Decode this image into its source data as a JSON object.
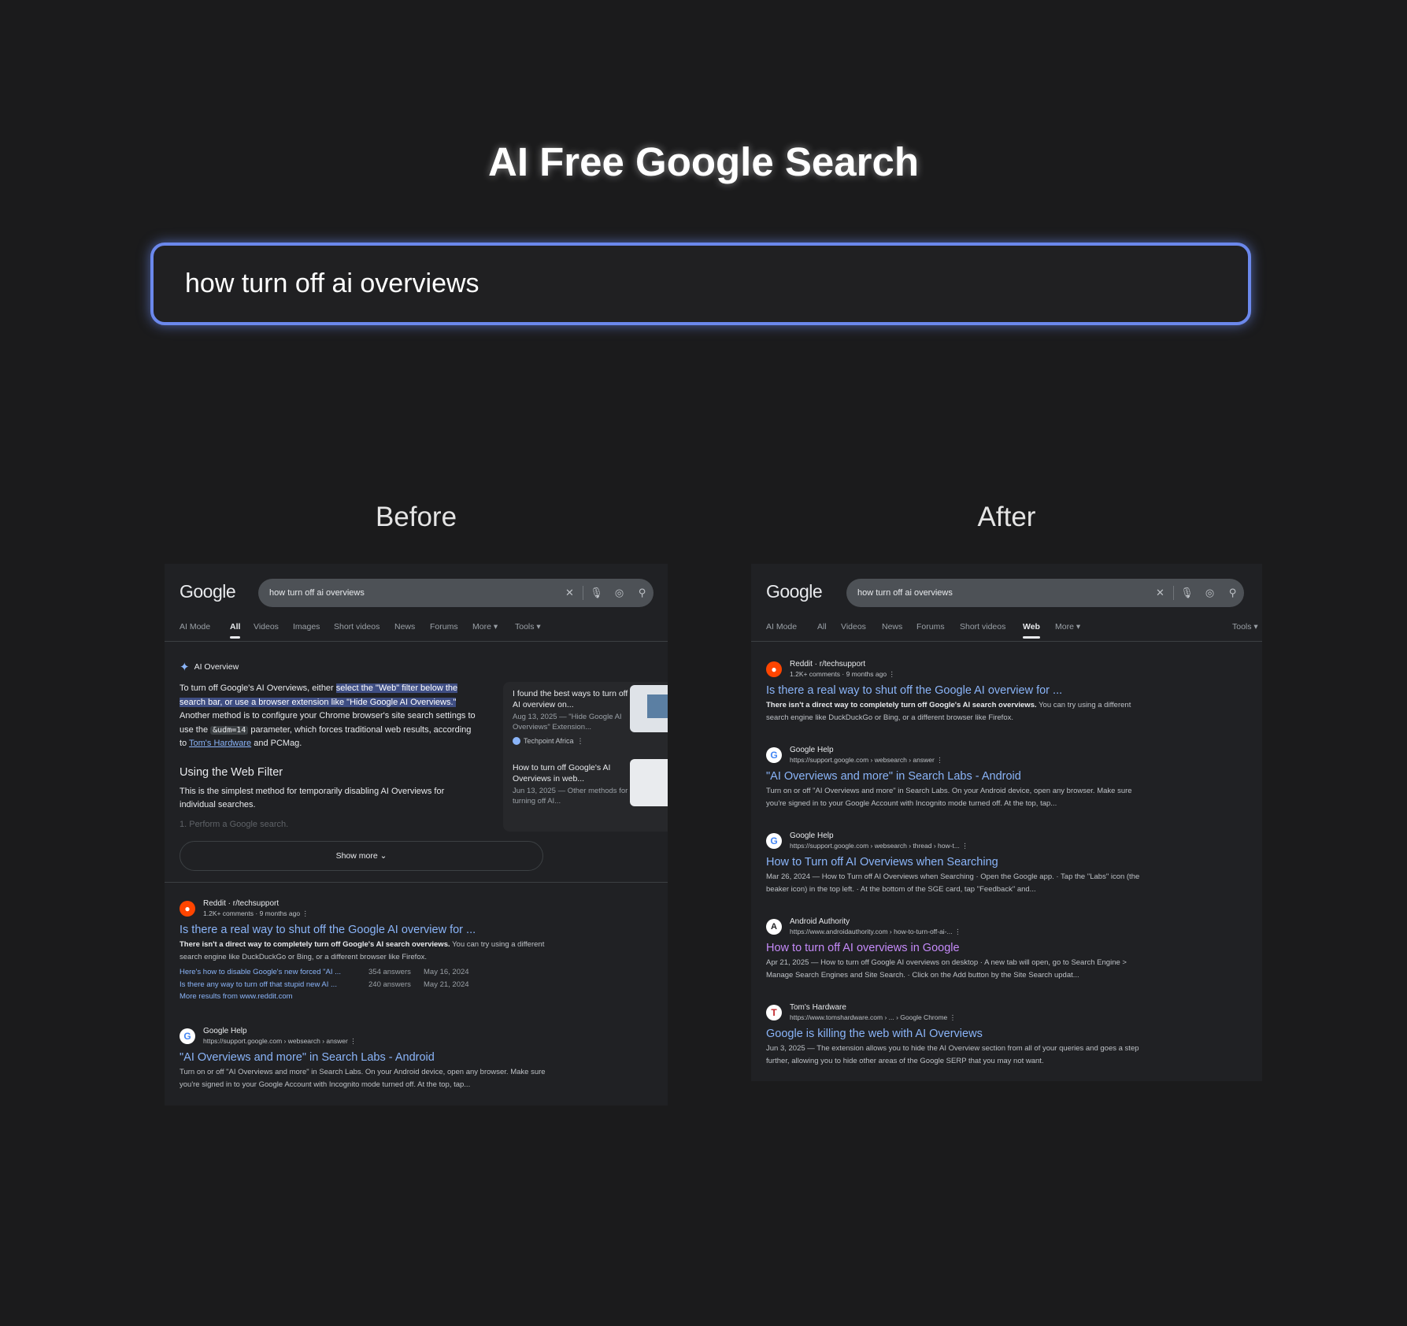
{
  "page": {
    "title": "AI Free Google Search",
    "search_value": "how turn off ai overviews",
    "before_label": "Before",
    "after_label": "After"
  },
  "shared": {
    "logo": "Google",
    "query": "how turn off ai overviews"
  },
  "before": {
    "tabs": [
      "AI Mode",
      "All",
      "Videos",
      "Images",
      "Short videos",
      "News",
      "Forums",
      "More ▾",
      "Tools ▾"
    ],
    "active_tab": "All",
    "ai_overview": {
      "heading": "AI Overview",
      "p1_a": "To turn off Google's AI Overviews, either ",
      "p1_hl": "select the \"Web\" filter below the search bar, or use a browser extension like \"Hide Google AI Overviews.\"",
      "p1_b": " Another method is to configure your Chrome browser's site search settings to use the ",
      "p1_code": "&udm=14",
      "p1_c": " parameter, which forces traditional web results, according to ",
      "p1_link": "Tom's Hardware",
      "p1_d": " and PCMag.",
      "h3": "Using the Web Filter",
      "sub": "This is the simplest method for temporarily disabling AI Overviews for individual searches.",
      "faded": "1.   Perform a Google search.",
      "show_more": "Show more ⌄"
    },
    "side_cards": [
      {
        "title": "I found the best ways to turn off AI overview on...",
        "meta": "Aug 13, 2025 — \"Hide Google AI Overviews\" Extension...",
        "source": "Techpoint Africa"
      },
      {
        "title": "How to turn off Google's AI Overviews in web...",
        "meta": "Jun 13, 2025 — Other methods for turning off AI..."
      }
    ],
    "results": [
      {
        "site": "Reddit · r/techsupport",
        "url": "1.2K+ comments · 9 months ago  ⋮",
        "title": "Is there a real way to shut off the Google AI overview for ...",
        "snip_b": "There isn't a direct way to completely turn off Google's AI search overviews.",
        "snip": " You can try using a different search engine like DuckDuckGo or Bing, or a different browser like Firefox.",
        "links": [
          {
            "text": "Here's how to disable Google's new forced \"AI ...",
            "answers": "354 answers",
            "date": "May 16, 2024"
          },
          {
            "text": "Is there any way to turn off that stupid new AI ...",
            "answers": "240 answers",
            "date": "May 21, 2024"
          }
        ],
        "more": "More results from www.reddit.com"
      },
      {
        "site": "Google Help",
        "url": "https://support.google.com › websearch › answer  ⋮",
        "title": "\"AI Overviews and more\" in Search Labs - Android",
        "snip": "Turn on or off \"AI Overviews and more\" in Search Labs. On your Android device, open any browser. Make sure you're signed in to your Google Account with Incognito mode turned off. At the top, tap..."
      }
    ]
  },
  "after": {
    "tabs": [
      "AI Mode",
      "All",
      "Videos",
      "News",
      "Forums",
      "Short videos",
      "Web",
      "More ▾",
      "Tools ▾"
    ],
    "active_tab": "Web",
    "results": [
      {
        "site": "Reddit · r/techsupport",
        "url": "1.2K+ comments · 9 months ago  ⋮",
        "title": "Is there a real way to shut off the Google AI overview for ...",
        "snip_b": "There isn't a direct way to completely turn off Google's AI search overviews.",
        "snip": " You can try using a different search engine like DuckDuckGo or Bing, or a different browser like Firefox."
      },
      {
        "site": "Google Help",
        "url": "https://support.google.com › websearch › answer  ⋮",
        "title": "\"AI Overviews and more\" in Search Labs - Android",
        "snip": "Turn on or off \"AI Overviews and more\" in Search Labs. On your Android device, open any browser. Make sure you're signed in to your Google Account with Incognito mode turned off. At the top, tap..."
      },
      {
        "site": "Google Help",
        "url": "https://support.google.com › websearch › thread › how-t...  ⋮",
        "title": "How to Turn off AI Overviews when Searching",
        "snip": "Mar 26, 2024 — How to Turn off AI Overviews when Searching · Open the Google app. · Tap the \"Labs\" icon (the beaker icon) in the top left. · At the bottom of the SGE card, tap \"Feedback\" and..."
      },
      {
        "site": "Android Authority",
        "url": "https://www.androidauthority.com › how-to-turn-off-ai-...  ⋮",
        "title": "How to turn off AI overviews in Google",
        "snip": "Apr 21, 2025 — How to turn off Google AI overviews on desktop · A new tab will open, go to Search Engine > Manage Search Engines and Site Search. · Click on the Add button by the Site Search updat..."
      },
      {
        "site": "Tom's Hardware",
        "url": "https://www.tomshardware.com › ... › Google Chrome  ⋮",
        "title": "Google is killing the web with AI Overviews",
        "snip": "Jun 3, 2025 — The extension allows you to hide the AI Overview section from all of your queries and goes a step further, allowing you to hide other areas of the Google SERP that you may not want."
      }
    ]
  },
  "colors": {
    "accent": "#6b88ec",
    "link": "#8ab4f8",
    "visited": "#c58af9",
    "highlight": "#3f4e83"
  },
  "icons": [
    "close-icon",
    "mic-icon",
    "lens-icon",
    "search-icon",
    "sparkle-icon",
    "chevron-down-icon",
    "reddit-icon",
    "google-icon",
    "android-authority-icon",
    "toms-hardware-icon",
    "more-vert-icon"
  ]
}
